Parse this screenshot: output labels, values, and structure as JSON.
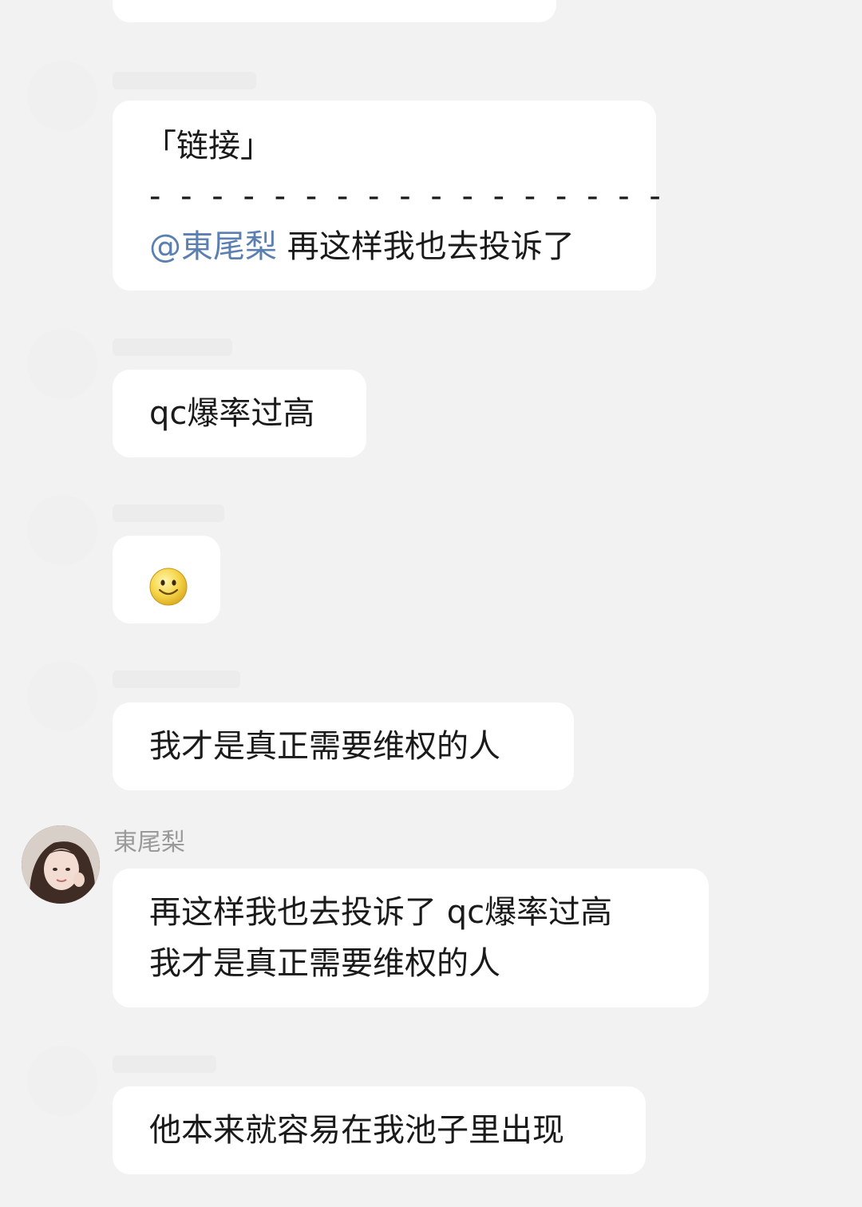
{
  "messages": [
    {
      "type": "quote",
      "quote_label": "「链接」",
      "divider": "- - - - - - - - - - - - - - - - -",
      "mention": "@東尾梨",
      "text": "再这样我也去投诉了"
    },
    {
      "type": "text",
      "text": "qc爆率过高"
    },
    {
      "type": "emoji",
      "emoji": "smile-emoji"
    },
    {
      "type": "text",
      "text": "我才是真正需要维权的人"
    },
    {
      "type": "text",
      "sender": "東尾梨",
      "line1": "再这样我也去投诉了 qc爆率过高",
      "line2": "我才是真正需要维权的人"
    },
    {
      "type": "text",
      "text": "他本来就容易在我池子里出现"
    }
  ]
}
